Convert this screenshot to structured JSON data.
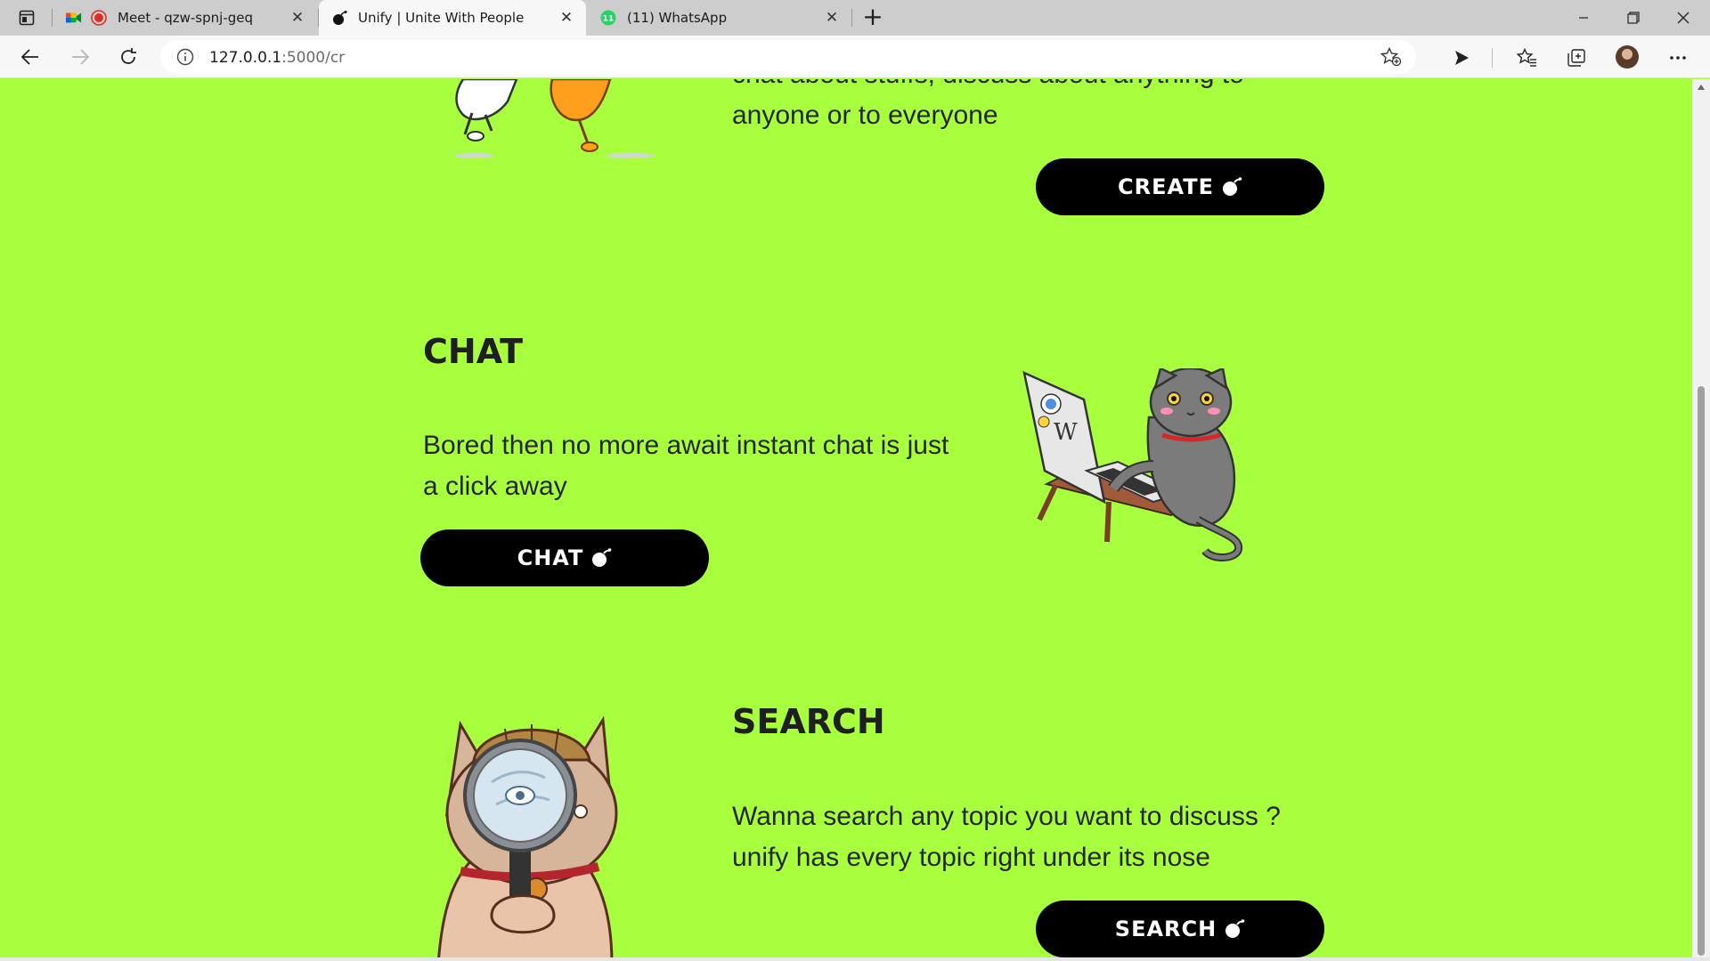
{
  "browser": {
    "tabs": [
      {
        "title": "Meet - qzw-spnj-geq",
        "active": false
      },
      {
        "title": "Unify | Unite With People",
        "active": true
      },
      {
        "title": "(11) WhatsApp",
        "active": false
      }
    ],
    "whatsapp_badge": "11",
    "url_host": "127.0.0.1",
    "url_path": ":5000/cr"
  },
  "sections": {
    "create": {
      "text_cut": "chat about stuffs, discuss about anything to",
      "text_line": "anyone or to everyone",
      "button_label": "CREATE"
    },
    "chat": {
      "heading": "CHAT",
      "text": "Bored then no more await instant chat is just a click away",
      "button_label": "CHAT"
    },
    "search": {
      "heading": "SEARCH",
      "text": "Wanna search any topic you want to discuss ? unify has every topic right under its nose",
      "button_label": "SEARCH"
    }
  },
  "colors": {
    "page_bg": "#a8ff3e",
    "button_bg": "#000000",
    "button_text": "#ffffff"
  }
}
